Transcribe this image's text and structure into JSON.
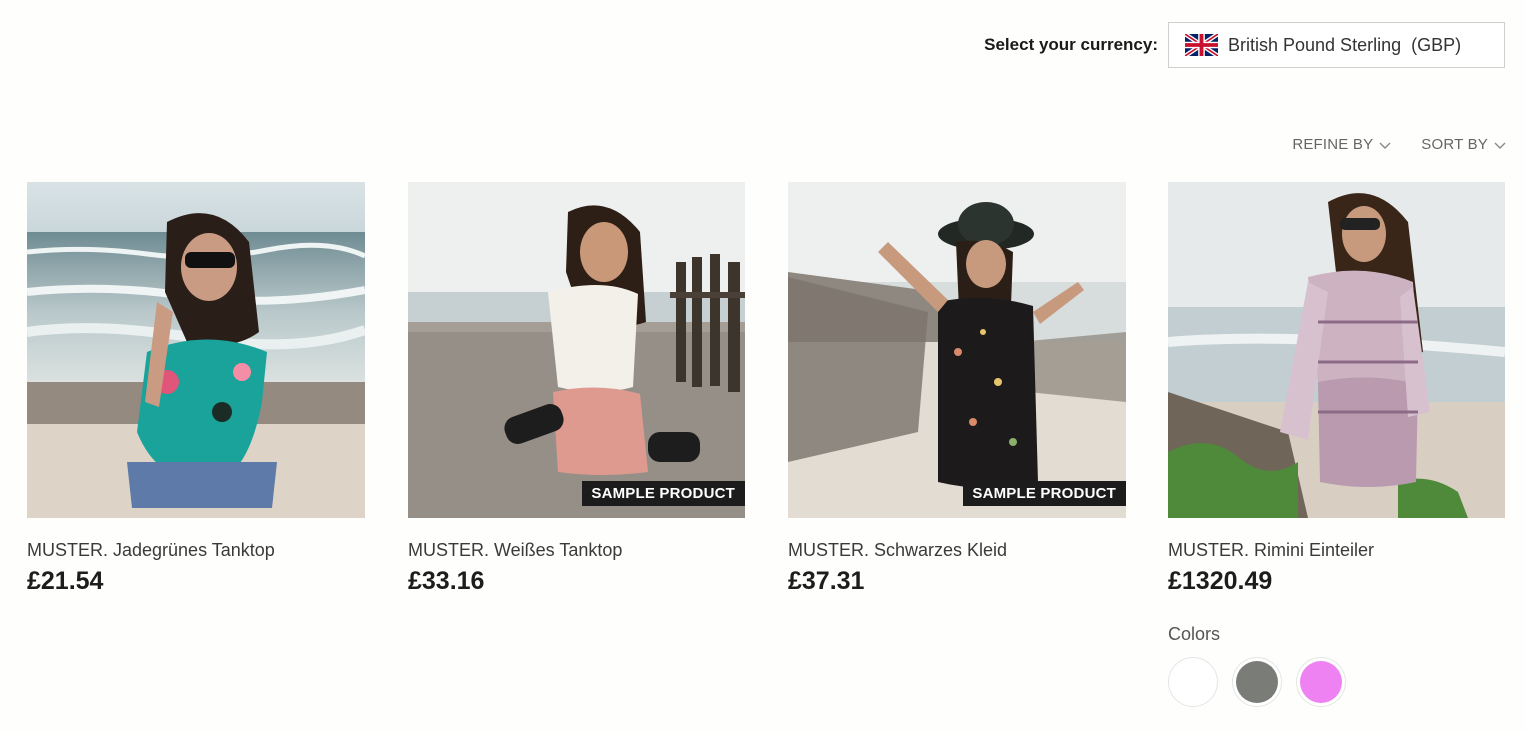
{
  "currency": {
    "label": "Select your currency:",
    "selected": "British Pound Sterling  (GBP)",
    "flag_icon": "uk-flag-icon"
  },
  "toolbar": {
    "refine_label": "REFINE BY",
    "sort_label": "SORT BY"
  },
  "products": [
    {
      "name": "MUSTER. Jadegrünes Tanktop",
      "price": "£21.54",
      "badge": ""
    },
    {
      "name": "MUSTER. Weißes Tanktop",
      "price": "£33.16",
      "badge": "SAMPLE PRODUCT"
    },
    {
      "name": "MUSTER. Schwarzes Kleid",
      "price": "£37.31",
      "badge": "SAMPLE PRODUCT"
    },
    {
      "name": "MUSTER. Rimini Einteiler",
      "price": "£1320.49",
      "badge": "",
      "colors_label": "Colors",
      "colors": [
        "#ffffff",
        "#7a7c78",
        "#ee82f2"
      ]
    }
  ]
}
